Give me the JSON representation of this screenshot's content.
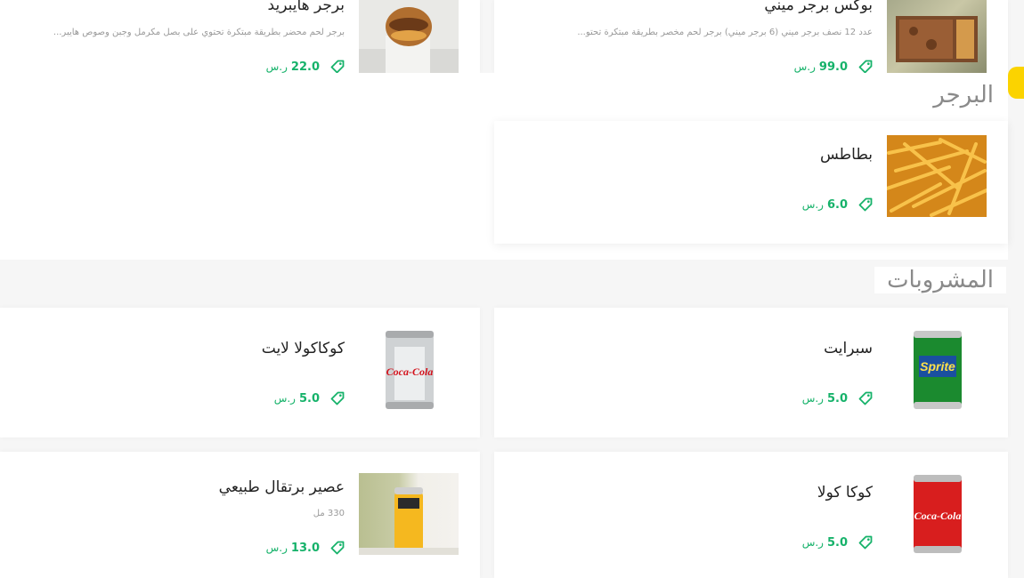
{
  "sections": {
    "burger_title": "البرجر",
    "drinks_title": "المشروبات"
  },
  "items": {
    "burger_mini_box": {
      "name": "بوكس برجر ميني",
      "desc": "عدد 12 نصف برجر ميني (6 برجر ميني) برجر لحم مخصر بطريقة مبتكرة تحتو...",
      "price": "99.0",
      "currency": "ر.س"
    },
    "burger_hybrid": {
      "name": "برجر هايبريد",
      "desc": "برجر لحم محضر بطريقة مبتكرة تحتوي على بصل مكرمل وجبن وصوص هايبر...",
      "price": "22.0",
      "currency": "ر.س"
    },
    "fries": {
      "name": "بطاطس",
      "price": "6.0",
      "currency": "ر.س"
    },
    "sprite": {
      "name": "سبرايت",
      "price": "5.0",
      "currency": "ر.س"
    },
    "coke_light": {
      "name": "كوكاكولا لايت",
      "price": "5.0",
      "currency": "ر.س"
    },
    "coca_cola": {
      "name": "كوكا كولا",
      "price": "5.0",
      "currency": "ر.س"
    },
    "orange_juice": {
      "name": "عصير برتقال طبيعي",
      "desc": "330 مل",
      "price": "13.0",
      "currency": "ر.س"
    }
  },
  "icons": {
    "price_tag": "tag-icon"
  },
  "colors": {
    "price": "#16b26a",
    "accent": "#fbd300"
  }
}
